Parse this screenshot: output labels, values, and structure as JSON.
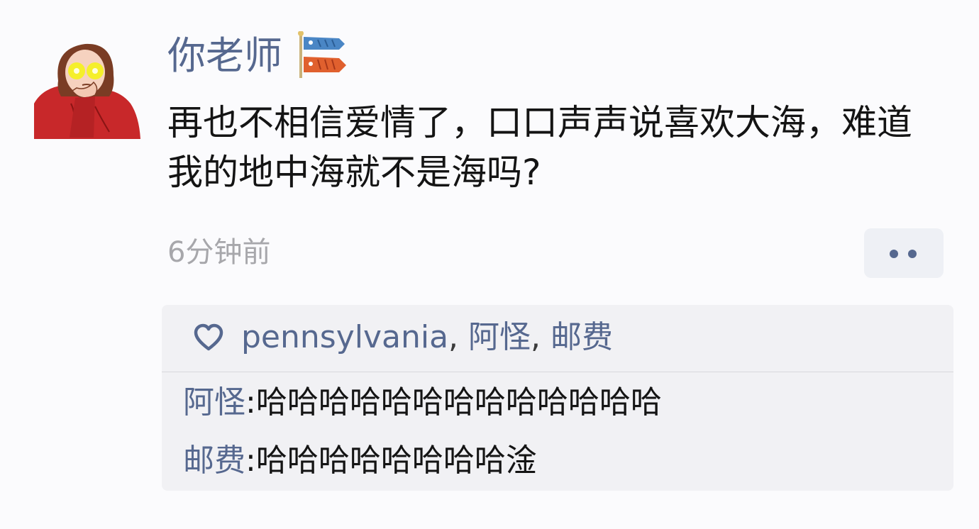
{
  "post": {
    "author": "你老师",
    "badge_icon": "carp-streamer-icon",
    "content": "再也不相信爱情了，口口声声说喜欢大海，难道我的地中海就不是海吗?",
    "timestamp": "6分钟前",
    "more_icon": "more-dots-icon"
  },
  "likes": {
    "icon": "heart-icon",
    "users": [
      "pennsylvania",
      "阿怪",
      "邮费"
    ],
    "separator": ", "
  },
  "comments": [
    {
      "author": "阿怪",
      "colon": ":",
      "text": "哈哈哈哈哈哈哈哈哈哈哈哈哈"
    },
    {
      "author": "邮费",
      "colon": ":",
      "text": "哈哈哈哈哈哈哈哈淦"
    }
  ],
  "colors": {
    "link": "#56688f",
    "text": "#141414",
    "muted": "#a7a7ab",
    "panel": "#f1f1f4",
    "avatar_shirt": "#c8282a",
    "avatar_glow": "#f5f21b"
  }
}
